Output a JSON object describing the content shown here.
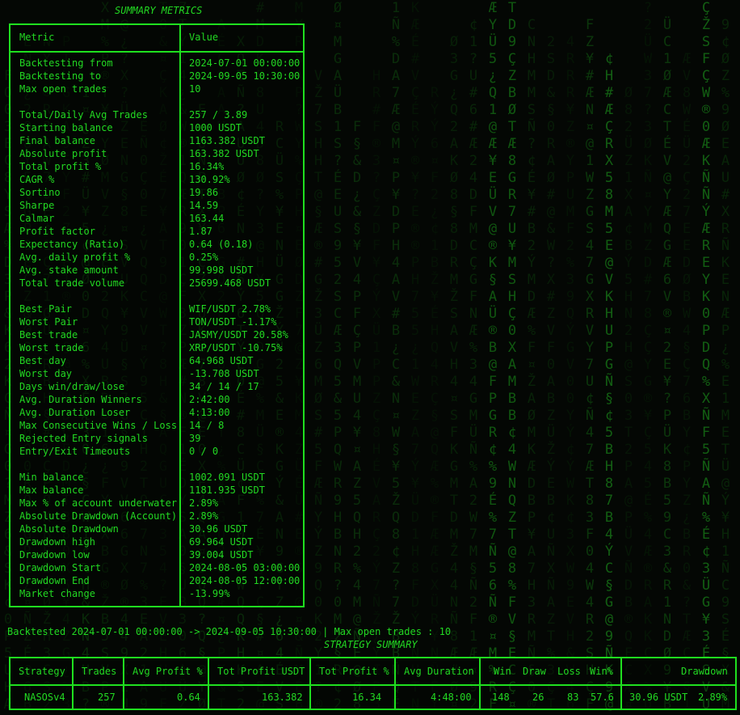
{
  "summary_title": "SUMMARY METRICS",
  "metrics_header": {
    "metric": "Metric",
    "value": "Value"
  },
  "metrics": [
    [
      "Backtesting from",
      "2024-07-01 00:00:00"
    ],
    [
      "Backtesting to",
      "2024-09-05 10:30:00"
    ],
    [
      "Max open trades",
      "10"
    ],
    [
      "",
      ""
    ],
    [
      "Total/Daily Avg Trades",
      "257 / 3.89"
    ],
    [
      "Starting balance",
      "1000 USDT"
    ],
    [
      "Final balance",
      "1163.382 USDT"
    ],
    [
      "Absolute profit",
      "163.382 USDT"
    ],
    [
      "Total profit %",
      "16.34%"
    ],
    [
      "CAGR %",
      "130.92%"
    ],
    [
      "Sortino",
      "19.86"
    ],
    [
      "Sharpe",
      "14.59"
    ],
    [
      "Calmar",
      "163.44"
    ],
    [
      "Profit factor",
      "1.87"
    ],
    [
      "Expectancy (Ratio)",
      "0.64 (0.18)"
    ],
    [
      "Avg. daily profit %",
      "0.25%"
    ],
    [
      "Avg. stake amount",
      "99.998 USDT"
    ],
    [
      "Total trade volume",
      "25699.468 USDT"
    ],
    [
      "",
      ""
    ],
    [
      "Best Pair",
      "WIF/USDT 2.78%"
    ],
    [
      "Worst Pair",
      "TON/USDT -1.17%"
    ],
    [
      "Best trade",
      "JASMY/USDT 20.58%"
    ],
    [
      "Worst trade",
      "XRP/USDT -10.75%"
    ],
    [
      "Best day",
      "64.968 USDT"
    ],
    [
      "Worst day",
      "-13.708 USDT"
    ],
    [
      "Days win/draw/lose",
      "34 / 14 / 17"
    ],
    [
      "Avg. Duration Winners",
      "2:42:00"
    ],
    [
      "Avg. Duration Loser",
      "4:13:00"
    ],
    [
      "Max Consecutive Wins / Loss",
      "14 / 8"
    ],
    [
      "Rejected Entry signals",
      "39"
    ],
    [
      "Entry/Exit Timeouts",
      "0 / 0"
    ],
    [
      "",
      ""
    ],
    [
      "Min balance",
      "1002.091 USDT"
    ],
    [
      "Max balance",
      "1181.935 USDT"
    ],
    [
      "Max % of account underwater",
      "2.89%"
    ],
    [
      "Absolute Drawdown (Account)",
      "2.89%"
    ],
    [
      "Absolute Drawdown",
      "30.96 USDT"
    ],
    [
      "Drawdown high",
      "69.964 USDT"
    ],
    [
      "Drawdown low",
      "39.004 USDT"
    ],
    [
      "Drawdown Start",
      "2024-08-05 03:00:00"
    ],
    [
      "Drawdown End",
      "2024-08-05 12:00:00"
    ],
    [
      "Market change",
      "-13.99%"
    ]
  ],
  "backtested_line": "Backtested 2024-07-01 00:00:00 -> 2024-09-05 10:30:00 | Max open trades : 10",
  "strategy_title": "STRATEGY SUMMARY",
  "strategy": {
    "headers": {
      "strategy": "Strategy",
      "trades": "Trades",
      "avg_profit": "Avg Profit %",
      "tot_profit_usdt": "Tot Profit USDT",
      "tot_profit_pct": "Tot Profit %",
      "avg_duration": "Avg Duration",
      "win": "Win",
      "draw": "Draw",
      "loss": "Loss",
      "winpct": "Win%",
      "drawdown": "Drawdown"
    },
    "row": {
      "strategy": "NASOSv4",
      "trades": "257",
      "avg_profit": "0.64",
      "tot_profit_usdt": "163.382",
      "tot_profit_pct": "16.34",
      "avg_duration": "4:48:00",
      "win": "148",
      "draw": "26",
      "loss": "83",
      "winpct": "57.6",
      "drawdown_usdt": "30.96 USDT",
      "drawdown_pct": "2.89%"
    }
  },
  "colors": {
    "accent": "#1fe01f",
    "text": "#22d822",
    "background": "#040704"
  }
}
